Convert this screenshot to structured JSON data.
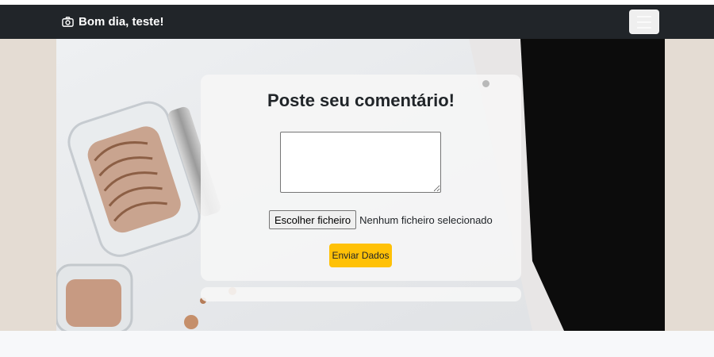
{
  "navbar": {
    "brand_text": "Bom dia, teste!",
    "brand_icon": "camera-icon",
    "toggler_icon": "hamburger-menu-icon"
  },
  "comment_form": {
    "title": "Poste seu comentário!",
    "textarea_value": "",
    "file_button_label": "Escolher ficheiro",
    "file_status": "Nenhum ficheiro selecionado",
    "submit_label": "Enviar Dados"
  },
  "colors": {
    "navbar_bg": "#212529",
    "accent": "#ffc107",
    "page_bg": "#e4dcd3"
  }
}
